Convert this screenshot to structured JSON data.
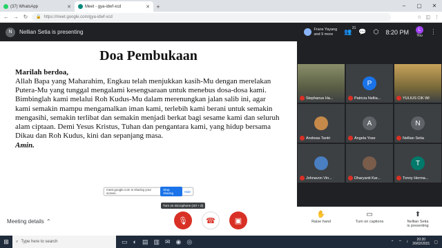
{
  "browser": {
    "tabs": [
      {
        "title": "(37) WhatsApp",
        "active": false,
        "icon_color": "#25d366"
      },
      {
        "title": "Meet - gya-idwf-xcd",
        "active": true,
        "icon_color": "#00897b"
      }
    ],
    "url_host": "https://meet.google.com/gya-idwf-xcd"
  },
  "meet_top": {
    "presenter_initial": "N",
    "presenter_label": "Nellian Setia is presenting",
    "joiners_line1": "Frans Yayang",
    "joiners_line2": "and 9 more",
    "people_count": "21",
    "clock": "8:20 PM",
    "you_initial": "L",
    "you_label": "You"
  },
  "slide": {
    "title": "Doa Pembukaan",
    "subtitle": "Marilah berdoa,",
    "body": "Allah Bapa yang Maharahim, Engkau telah menjukkan kasih-Mu dengan merelakan Putera-Mu yang tunggal mengalami kesengsaraan untuk menebus dosa-dosa kami. Bimbinglah kami melalui Roh Kudus-Mu dalam merenungkan jalan salib ini, agar kami semakin mampu mengamalkan iman kami, terlebih kami berani untuk semakin mengasihi, semakin terlibat dan semakin menjadi berkat bagi sesame kami dan seluruh alam ciptaan. Demi Yesus Kristus, Tuhan dan pengantara kami, yang hidup bersama Dikau dan Roh Kudus, kini dan sepanjang masa.",
    "amen": "Amin.",
    "share_text": "meet.google.com is sharing your screen.",
    "stop_label": "Stop sharing",
    "hide_label": "Hide"
  },
  "participants": [
    {
      "name": "Stephanus Ha...",
      "initial": "",
      "photo": true,
      "color": "#5f6368"
    },
    {
      "name": "Patricia Nellia...",
      "initial": "P",
      "photo": false,
      "color": "#1a73e8"
    },
    {
      "name": "YULIUS CIK WI",
      "initial": "",
      "photo": true,
      "color": "#b06000"
    },
    {
      "name": "Andreas Tantri",
      "initial": "",
      "photo": false,
      "color": "#c58a4a"
    },
    {
      "name": "Angela Yose",
      "initial": "A",
      "photo": false,
      "color": "#5f6368"
    },
    {
      "name": "Nellian Setia",
      "initial": "N",
      "photo": false,
      "color": "#5f6368"
    },
    {
      "name": "Johnavon Vin...",
      "initial": "",
      "photo": false,
      "color": "#4a7fc1"
    },
    {
      "name": "Dharyanti Kar...",
      "initial": "",
      "photo": false,
      "color": "#7a5c4a"
    },
    {
      "name": "Tonny Herma...",
      "initial": "T",
      "photo": false,
      "color": "#00796b"
    }
  ],
  "bottom": {
    "meeting_details": "Meeting details",
    "tooltip": "Turn on microphone (ctrl + d)",
    "raise_hand": "Raise hand",
    "captions": "Turn on captions",
    "presenting_line1": "Nellian Setia",
    "presenting_line2": "is presenting"
  },
  "taskbar": {
    "search_placeholder": "Type here to search",
    "time": "20:20",
    "date": "26/02/2021"
  },
  "colors": {
    "accent": "#1a73e8",
    "danger": "#d93025"
  }
}
